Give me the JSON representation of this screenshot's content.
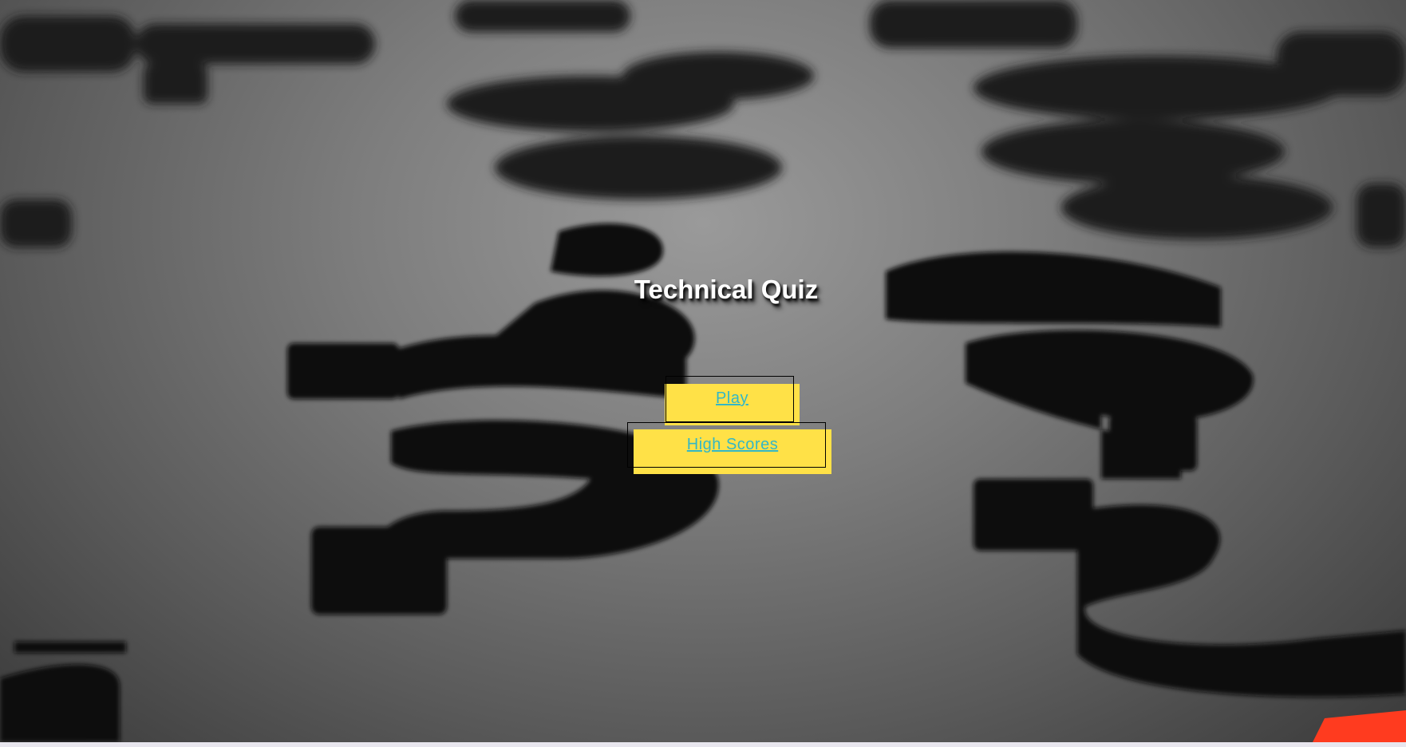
{
  "page": {
    "title": "Technical Quiz"
  },
  "menu": {
    "play_label": "Play",
    "high_scores_label": "High Scores"
  },
  "colors": {
    "button_bg": "#ffe147",
    "button_text": "#33b7c6",
    "title_text": "#ffffff",
    "accent_red": "#ff3b1f"
  },
  "background": {
    "icon": "question-marks-3d-background"
  }
}
